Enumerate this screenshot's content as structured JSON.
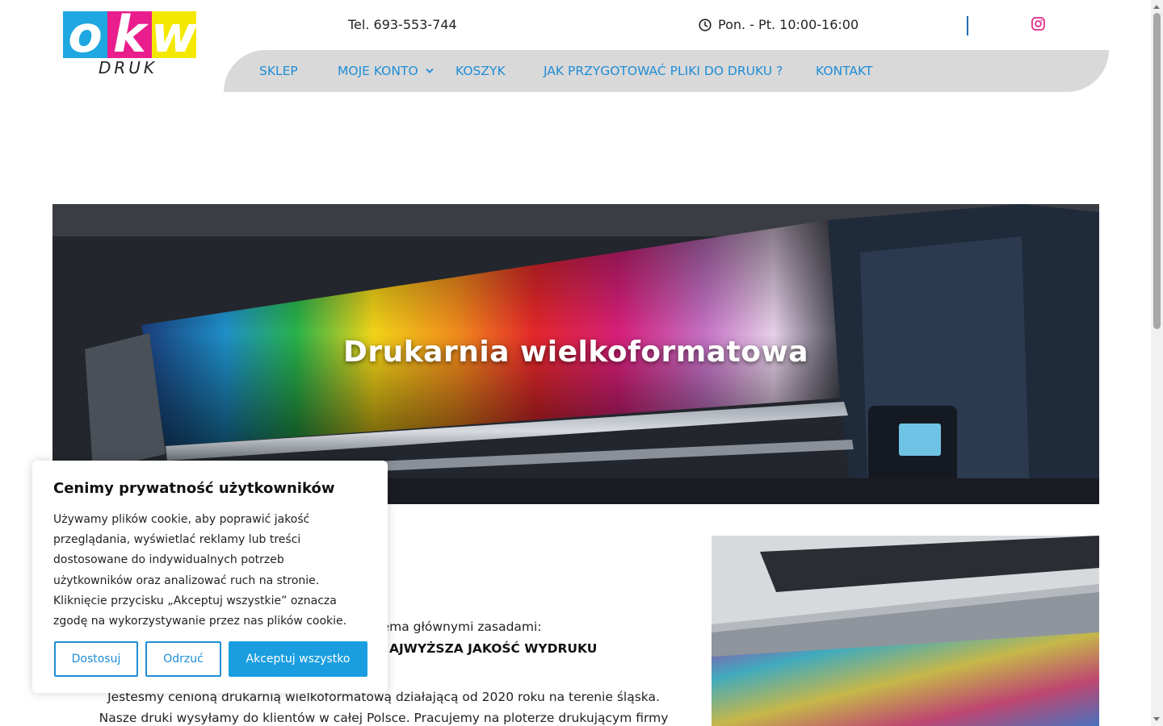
{
  "header": {
    "logo": {
      "letters": [
        "o",
        "k",
        "w"
      ],
      "subtitle": "DRUK"
    },
    "phone": "Tel. 693-553-744",
    "hours": "Pon. - Pt. 10:00-16:00",
    "clock_icon": "clock-icon",
    "social_icon": "instagram-icon"
  },
  "nav": {
    "items": [
      {
        "label": "SKLEP"
      },
      {
        "label": "MOJE KONTO"
      },
      {
        "label": "KOSZYK"
      },
      {
        "label": "JAK PRZYGOTOWAĆ PLIKI DO DRUKU ?"
      },
      {
        "label": "KONTAKT"
      }
    ],
    "dropdown_icon": "chevron-down-icon"
  },
  "hero": {
    "title": "Drukarnia wielkoformatowa"
  },
  "content": {
    "intro_fragment": "trzema głównymi zasadami:",
    "bold_fragment": "AJWYŻSZA JAKOŚĆ WYDRUKU",
    "paragraph_line1": "Jesteśmy cenioną drukarnią wielkoformatową działającą od 2020 roku na terenie śląska.",
    "paragraph_line2": "Nasze druki wysyłamy do klientów w całej Polsce. Pracujemy na ploterze drukującym firmy"
  },
  "cookie": {
    "title": "Cenimy prywatność użytkowników",
    "body": "Używamy plików cookie, aby poprawić jakość przeglądania, wyświetlać reklamy lub treści dostosowane do indywidualnych potrzeb użytkowników oraz analizować ruch na stronie. Kliknięcie przycisku „Akceptuj wszystkie” oznacza zgodę na wykorzystywanie przez nas plików cookie.",
    "buttons": {
      "customize": "Dostosuj",
      "reject": "Odrzuć",
      "accept": "Akceptuj wszystko"
    }
  },
  "colors": {
    "accent": "#1f8dd6",
    "nav_bg": "#d9d9d9",
    "logo_cyan": "#1ea7e1",
    "logo_magenta": "#e91e8c",
    "logo_yellow": "#f5e800"
  }
}
